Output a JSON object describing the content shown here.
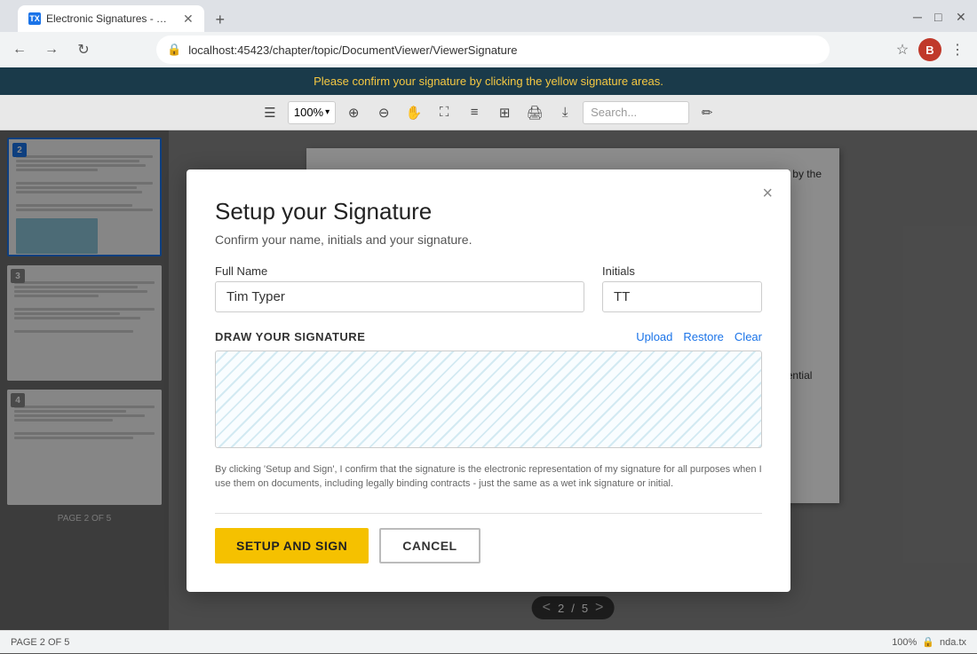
{
  "browser": {
    "tab_title": "Electronic Signatures - Text Cont...",
    "url": "localhost:45423/chapter/topic/DocumentViewer/ViewerSignature",
    "new_tab_label": "+",
    "profile_initial": "B"
  },
  "notification_bar": {
    "message": "Please confirm your signature by clicking the yellow signature areas."
  },
  "toolbar": {
    "zoom_level": "100%",
    "search_placeholder": "Search..."
  },
  "sidebar": {
    "page_label": "PAGE 2 OF 5",
    "thumbs": [
      {
        "num": "2",
        "active": true
      },
      {
        "num": "3",
        "active": false
      },
      {
        "num": "4",
        "active": false
      }
    ]
  },
  "content": {
    "text1": "eof by the",
    "text2": "Notwithstanding anything in the foregoing to the contrary, the Receiving Party may disclose Confidential Information pursuant to any governmental, judicial, or administrative order,"
  },
  "page_nav": {
    "current": "2",
    "total": "5",
    "separator": "/",
    "prev": "<",
    "next": ">"
  },
  "status_bar": {
    "page_info": "100%",
    "lock_icon": "🔒",
    "doc_name": "nda.tx"
  },
  "modal": {
    "title": "Setup your Signature",
    "close_label": "×",
    "subtitle": "Confirm your name, initials and your signature.",
    "full_name_label": "Full Name",
    "full_name_value": "Tim Typer",
    "initials_label": "Initials",
    "initials_value": "TT",
    "draw_signature_label": "DRAW YOUR SIGNATURE",
    "upload_btn": "Upload",
    "restore_btn": "Restore",
    "clear_btn": "Clear",
    "legal_text": "By clicking 'Setup and Sign', I confirm that the signature is the electronic representation of my signature for all purposes when I use them on documents, including legally binding contracts - just the same as a wet ink signature or initial.",
    "setup_btn": "SETUP AND SIGN",
    "cancel_btn": "CANCEL"
  }
}
